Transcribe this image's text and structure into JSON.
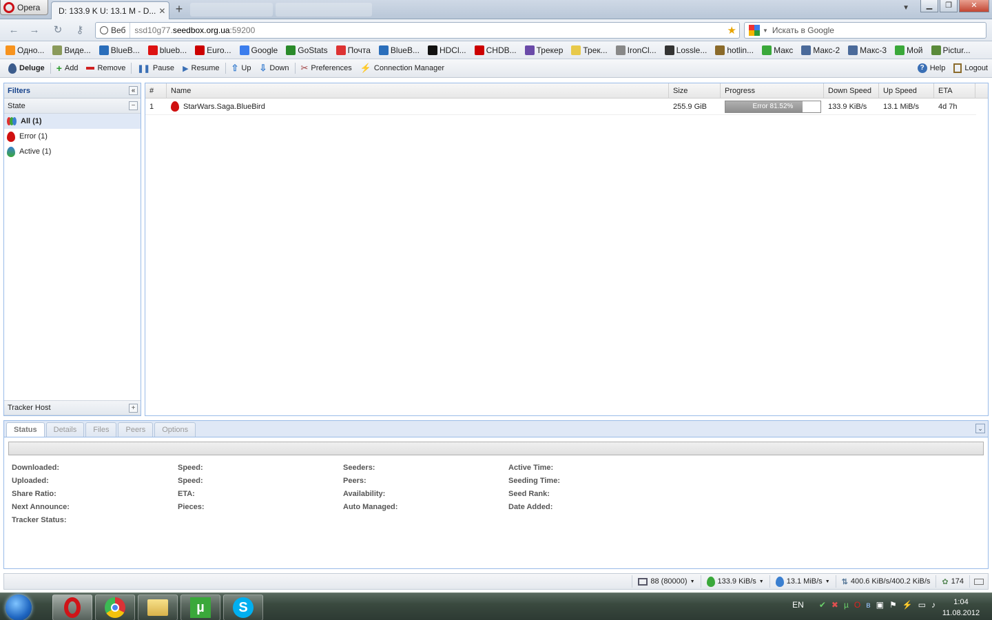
{
  "browser": {
    "menu_label": "Opera",
    "active_tab_title": "D: 133.9 K U: 13.1 M - D...",
    "address_badge": "Веб",
    "url_prefix": "ssd10g77.",
    "url_host": "seedbox.org.ua",
    "url_suffix": ":59200",
    "search_placeholder": "Искать в Google"
  },
  "bookmarks": [
    {
      "label": "Одно...",
      "icon": "odnoklassniki-icon",
      "color": "#f7931e"
    },
    {
      "label": "Виде...",
      "icon": "video-icon",
      "color": "#8a9a5b"
    },
    {
      "label": "BlueB...",
      "icon": "bluebird-icon",
      "color": "#2a6ebb"
    },
    {
      "label": "blueb...",
      "icon": "youtube-icon",
      "color": "#d11"
    },
    {
      "label": "Euro...",
      "icon": "euro-icon",
      "color": "#c00"
    },
    {
      "label": "Google",
      "icon": "google-icon",
      "color": "#3b7ded"
    },
    {
      "label": "GoStats",
      "icon": "gostats-icon",
      "color": "#2a8a2a"
    },
    {
      "label": "Почта",
      "icon": "mail-icon",
      "color": "#d33"
    },
    {
      "label": "BlueB...",
      "icon": "bluebird-icon",
      "color": "#2a6ebb"
    },
    {
      "label": "HDCl...",
      "icon": "hd-icon",
      "color": "#111"
    },
    {
      "label": "CHDB...",
      "icon": "chdbits-icon",
      "color": "#c00"
    },
    {
      "label": "Трекер",
      "icon": "tracker-icon",
      "color": "#6a4aa8"
    },
    {
      "label": "Трек...",
      "icon": "tracker2-icon",
      "color": "#e8c94a"
    },
    {
      "label": "IronCl...",
      "icon": "ironclaw-icon",
      "color": "#888"
    },
    {
      "label": "Lossle...",
      "icon": "lossless-icon",
      "color": "#333"
    },
    {
      "label": "hotlin...",
      "icon": "hotline-icon",
      "color": "#8a6a2a"
    },
    {
      "label": "Макс",
      "icon": "utorrent-icon",
      "color": "#3aa83a"
    },
    {
      "label": "Макс-2",
      "icon": "deluge-icon",
      "color": "#4a6a9a"
    },
    {
      "label": "Макс-3",
      "icon": "deluge-icon",
      "color": "#4a6a9a"
    },
    {
      "label": "Мой",
      "icon": "utorrent-icon",
      "color": "#3aa83a"
    },
    {
      "label": "Pictur...",
      "icon": "picture-icon",
      "color": "#5a8a3a"
    }
  ],
  "toolbar": {
    "app_name": "Deluge",
    "add": "Add",
    "remove": "Remove",
    "pause": "Pause",
    "resume": "Resume",
    "up": "Up",
    "down": "Down",
    "preferences": "Preferences",
    "connection_manager": "Connection Manager",
    "help": "Help",
    "logout": "Logout"
  },
  "filters": {
    "title": "Filters",
    "state_title": "State",
    "items": [
      {
        "label": "All (1)",
        "icon": "all-states-icon"
      },
      {
        "label": "Error (1)",
        "icon": "error-icon",
        "color": "#d01010"
      },
      {
        "label": "Active (1)",
        "icon": "active-icon",
        "color": "#3a7fd0"
      }
    ],
    "tracker_title": "Tracker Host"
  },
  "grid": {
    "columns": [
      "#",
      "Name",
      "Size",
      "Progress",
      "Down Speed",
      "Up Speed",
      "ETA"
    ],
    "rows": [
      {
        "num": "1",
        "name": "StarWars.Saga.BlueBird",
        "size": "255.9 GiB",
        "progress_label": "Error 81.52%",
        "progress_fraction": 0.8152,
        "down": "133.9 KiB/s",
        "up": "13.1 MiB/s",
        "eta": "4d 7h"
      }
    ]
  },
  "details": {
    "tabs": [
      "Status",
      "Details",
      "Files",
      "Peers",
      "Options"
    ],
    "col1": [
      "Downloaded:",
      "Uploaded:",
      "Share Ratio:",
      "Next Announce:",
      "Tracker Status:"
    ],
    "col2": [
      "Speed:",
      "Speed:",
      "ETA:",
      "Pieces:"
    ],
    "col3": [
      "Seeders:",
      "Peers:",
      "Availability:",
      "Auto Managed:"
    ],
    "col4": [
      "Active Time:",
      "Seeding Time:",
      "Seed Rank:",
      "Date Added:"
    ]
  },
  "statusbar": {
    "connections": "88 (80000)",
    "down_speed": "133.9 KiB/s",
    "up_speed": "13.1 MiB/s",
    "protocol": "400.6 KiB/s/400.2 KiB/s",
    "dht": "174"
  },
  "taskbar": {
    "language": "EN",
    "time": "1:04",
    "date": "11.08.2012"
  }
}
